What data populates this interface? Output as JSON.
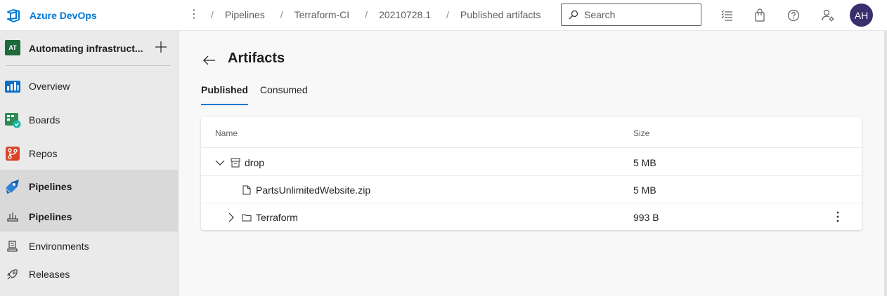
{
  "app": {
    "name": "Azure DevOps"
  },
  "breadcrumbs": [
    "Pipelines",
    "Terraform-CI",
    "20210728.1",
    "Published artifacts"
  ],
  "search": {
    "placeholder": "Search"
  },
  "user": {
    "initials": "AH"
  },
  "project": {
    "badge": "AT",
    "name": "Automating infrastruct..."
  },
  "sidebar": {
    "items": [
      {
        "label": "Overview"
      },
      {
        "label": "Boards"
      },
      {
        "label": "Repos"
      },
      {
        "label": "Pipelines"
      },
      {
        "label": "Pipelines"
      },
      {
        "label": "Environments"
      },
      {
        "label": "Releases"
      }
    ]
  },
  "page": {
    "title": "Artifacts",
    "tabs": [
      {
        "label": "Published"
      },
      {
        "label": "Consumed"
      }
    ]
  },
  "table": {
    "columns": {
      "name": "Name",
      "size": "Size"
    },
    "rows": [
      {
        "name": "drop",
        "size": "5 MB"
      },
      {
        "name": "PartsUnlimitedWebsite.zip",
        "size": "5 MB"
      },
      {
        "name": "Terraform",
        "size": "993 B"
      }
    ]
  },
  "colors": {
    "accent": "#0078d4",
    "avatar": "#3a2e6e",
    "project_badge": "#1e6a3b"
  }
}
